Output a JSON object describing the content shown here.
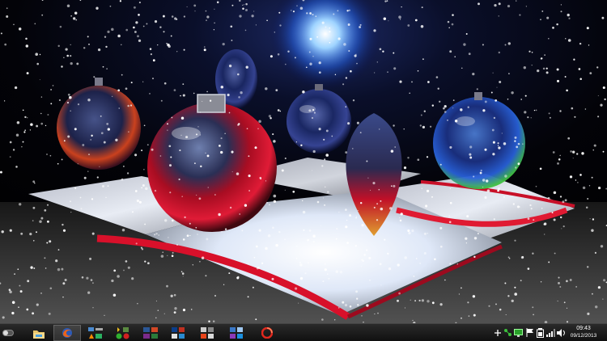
{
  "desktop": {
    "wallpaper": "Christmas baubles on silver gift boxes with falling snow",
    "colors": {
      "ornament_red": "#c8102e",
      "glow_blue": "#4aa8ff",
      "ribbon_red": "#e0102a"
    }
  },
  "taskbar": {
    "pinned": [
      {
        "name": "toggle-switch-icon"
      },
      {
        "name": "file-explorer-icon"
      },
      {
        "name": "firefox-icon"
      },
      {
        "name": "app-group-1-icon"
      },
      {
        "name": "app-group-2-icon"
      },
      {
        "name": "app-group-3-icon"
      },
      {
        "name": "app-group-4-icon"
      },
      {
        "name": "app-group-5-icon"
      },
      {
        "name": "app-group-6-icon"
      },
      {
        "name": "app-group-7-icon"
      },
      {
        "name": "opera-icon"
      }
    ],
    "tray": [
      {
        "name": "show-hidden-icons-icon"
      },
      {
        "name": "network-share-icon"
      },
      {
        "name": "monitor-icon"
      },
      {
        "name": "action-center-flag-icon"
      },
      {
        "name": "power-icon"
      },
      {
        "name": "signal-icon"
      },
      {
        "name": "volume-icon"
      }
    ],
    "clock": {
      "time": "09:43",
      "date": "09/12/2013"
    }
  }
}
